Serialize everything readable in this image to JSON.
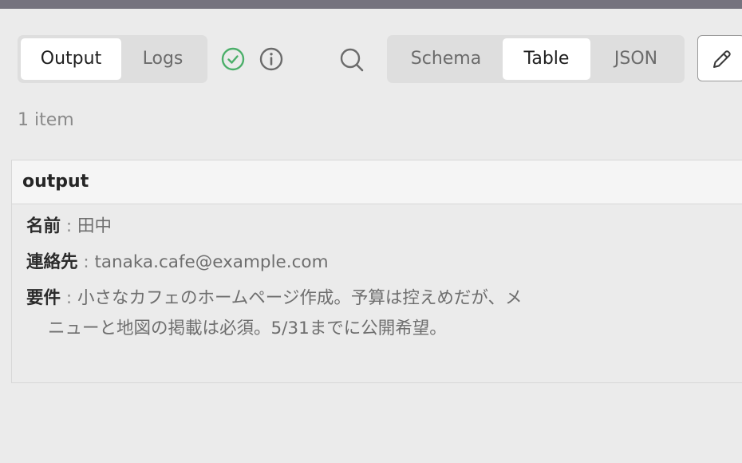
{
  "tabs_left": [
    {
      "label": "Output",
      "active": true
    },
    {
      "label": "Logs",
      "active": false
    }
  ],
  "view_tabs": [
    {
      "label": "Schema",
      "active": false
    },
    {
      "label": "Table",
      "active": true
    },
    {
      "label": "JSON",
      "active": false
    }
  ],
  "icons": {
    "status": "check-circle-icon",
    "info": "info-icon",
    "search": "search-icon",
    "edit": "pencil-icon"
  },
  "colors": {
    "success": "#4caf6a",
    "topbar": "#75737e"
  },
  "item_count": "1 item",
  "table": {
    "header": "output",
    "fields": [
      {
        "key": "名前",
        "sep": ":",
        "value": "田中"
      },
      {
        "key": "連絡先",
        "sep": ":",
        "value": "tanaka.cafe@example.com"
      },
      {
        "key": "要件",
        "sep": ":",
        "value": "小さなカフェのホームページ作成。予算は控えめだが、メニューと地図の掲載は必須。5/31までに公開希望。"
      }
    ]
  }
}
